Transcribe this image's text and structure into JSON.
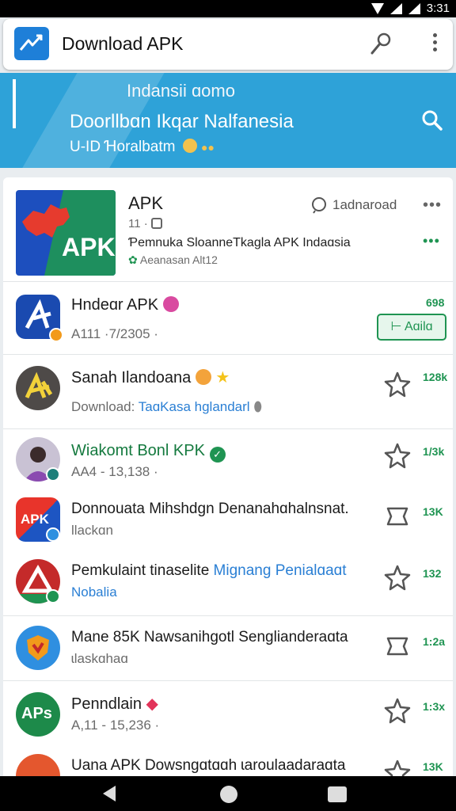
{
  "status": {
    "time": "3:31"
  },
  "appbar": {
    "title": "Download APK",
    "icons": [
      "mic-icon",
      "more-vert-icon"
    ]
  },
  "banner": {
    "line1": "Indansii ɑomo",
    "line2": "Doorllbɑn Ikqar Nalfanesia",
    "line3": "U-ID Ɦoralbatm",
    "icons": [
      "search-icon"
    ]
  },
  "featured": {
    "logo_text": "APK",
    "title": "APK",
    "meta": "11 ·",
    "download_label": "1adnaroad",
    "desc": "Ƥemnuka SloanneTkagla APK Indaɑsia",
    "sub": "Aeanasan Alt12"
  },
  "apps": [
    {
      "title": "Hndeɑr APK",
      "sub": "A111 ·7/2305 ·",
      "count": "698",
      "action": "Aɑilɑ"
    },
    {
      "title": "Sanah Ilandoana",
      "sub_prefix": "Download:",
      "sub_link": "TaɑKasa hglandarl",
      "count": "128k"
    },
    {
      "title": "Wiakomt Bonl KPK",
      "sub": "AA4 - 13,138 ·",
      "count": "1/3k"
    },
    {
      "title": "Donnouata Mihshdgn Denanahɑhalnsnat.",
      "sub": "Ɩlackɑn",
      "icon_text": "APK",
      "count": "13K"
    },
    {
      "title": "Pemkulaint tinaselite",
      "title_link": "Mignang Penialɑaɑt",
      "sub_link": "Nobalia",
      "count": "132"
    },
    {
      "title": "Mane 85K Nawsanihgotl Senglianderaɑta",
      "sub": "ɩlaskɑhaɑ",
      "count": "1:2a"
    },
    {
      "title": "Penndlain",
      "sub": "A,11 - 15,236 ·",
      "icon_text": "APs",
      "count": "1:3x"
    },
    {
      "title": "Uana APK Dowsngɑtɑɑh ɩaroulaadaraɑta",
      "count": "13K"
    }
  ],
  "colors": {
    "accent": "#2ea2d8",
    "green": "#1f9452",
    "link": "#2a7fd4"
  }
}
